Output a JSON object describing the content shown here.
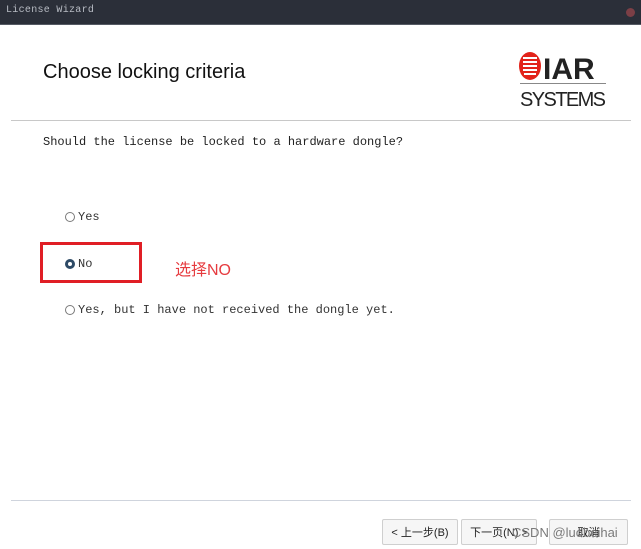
{
  "window": {
    "title": "License Wizard"
  },
  "header": {
    "title": "Choose locking criteria",
    "logo_top": "IAR",
    "logo_bottom": "SYSTEMS",
    "logo_color": "#e2231a"
  },
  "question": "Should the license be locked to a hardware dongle?",
  "options": [
    {
      "label": "Yes",
      "checked": false
    },
    {
      "label": "No",
      "checked": true
    },
    {
      "label": "Yes, but I have not received the dongle yet.",
      "checked": false
    }
  ],
  "annotation": {
    "text": "选择NO",
    "color": "#e63b3f"
  },
  "footer": {
    "back_label": "< 上一步(B)",
    "next_label": "下一页(N) >",
    "cancel_label": "取消"
  },
  "watermark": "CSDN @luobeihai"
}
